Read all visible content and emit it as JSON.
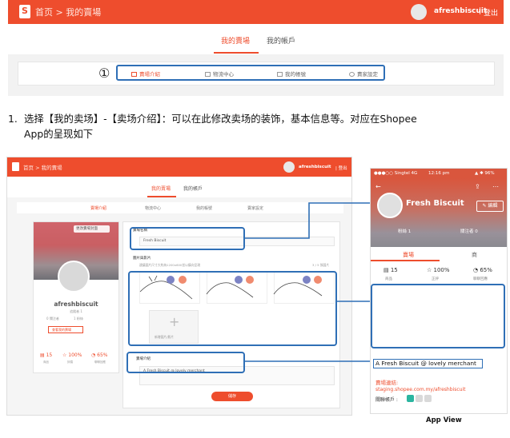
{
  "top_screenshot": {
    "breadcrumb": "首页 > 我的賣場",
    "username": "afreshbiscuit",
    "logout_sep": "|",
    "logout": "登出",
    "tabs": [
      "我的賣場",
      "我的帳戶"
    ],
    "step_marker": "①",
    "nav_items": [
      "賣場介紹",
      "物流中心",
      "我的帳號",
      "賣家設定"
    ]
  },
  "instruction": {
    "number": "1.",
    "line1": "选择【我的卖场】-【卖场介绍】：可以在此修改卖场的装饰，基本信息等。对应在Shopee",
    "line2": "App的呈现如下"
  },
  "web_screenshot": {
    "breadcrumb": "首页 > 我的賣場",
    "username": "afreshbiscuit",
    "logout": "| 登出",
    "tabs": [
      "我的賣場",
      "我的帳戶"
    ],
    "nav_items": [
      "賣場介紹",
      "物流中心",
      "我的帳號",
      "賣家設定"
    ],
    "cover_button": "更改賣場封面",
    "shop_name": "afreshbiscuit",
    "follow_info": "追蹤者 1",
    "mini_left": "0 關注者",
    "mini_right": "1 粉絲",
    "edit_button": "查看我的賣場",
    "stats": [
      {
        "value": "15",
        "label": "商品"
      },
      {
        "value": "100%",
        "label": "評價"
      },
      {
        "value": "65%",
        "label": "聊聊回應"
      }
    ],
    "field_shop_name_label": "賣場名稱",
    "field_shop_name_value": "Fresh Biscuit",
    "field_images_label": "圖片與影片",
    "field_images_hint": "建議圖片尺寸大約為1200x600並以橫向呈現",
    "field_images_count": "3 / 5 張圖片",
    "add_image_label": "新增圖片/影片",
    "field_desc_label": "賣場介紹",
    "field_desc_value": "A Fresh Biscuit @ lovely merchant",
    "save_button": "儲存"
  },
  "app_view": {
    "status_left": "●●●○○ Singtel  4G",
    "status_time": "12:16 pm",
    "status_right": "▲ ✱ 96%",
    "shop_name": "Fresh Biscuit",
    "edit_button": "✎ 編輯",
    "followers": "粉絲 1",
    "following": "關注者 0",
    "tabs": [
      "賣場",
      "商"
    ],
    "stats": [
      {
        "value": "15",
        "label": "商品"
      },
      {
        "value": "100%",
        "label": "正評"
      },
      {
        "value": "65%",
        "label": "聊聊回應"
      }
    ],
    "description": "A Fresh Biscuit @ lovely merchant",
    "link_label": "賣場連結:",
    "link_value": "staging.shopee.com.my/afreshbiscuit",
    "related_label": "關聯帳戶 :",
    "caption": "App View"
  },
  "colors": {
    "brand": "#ee4d2d",
    "highlight": "#2f6fb6"
  }
}
